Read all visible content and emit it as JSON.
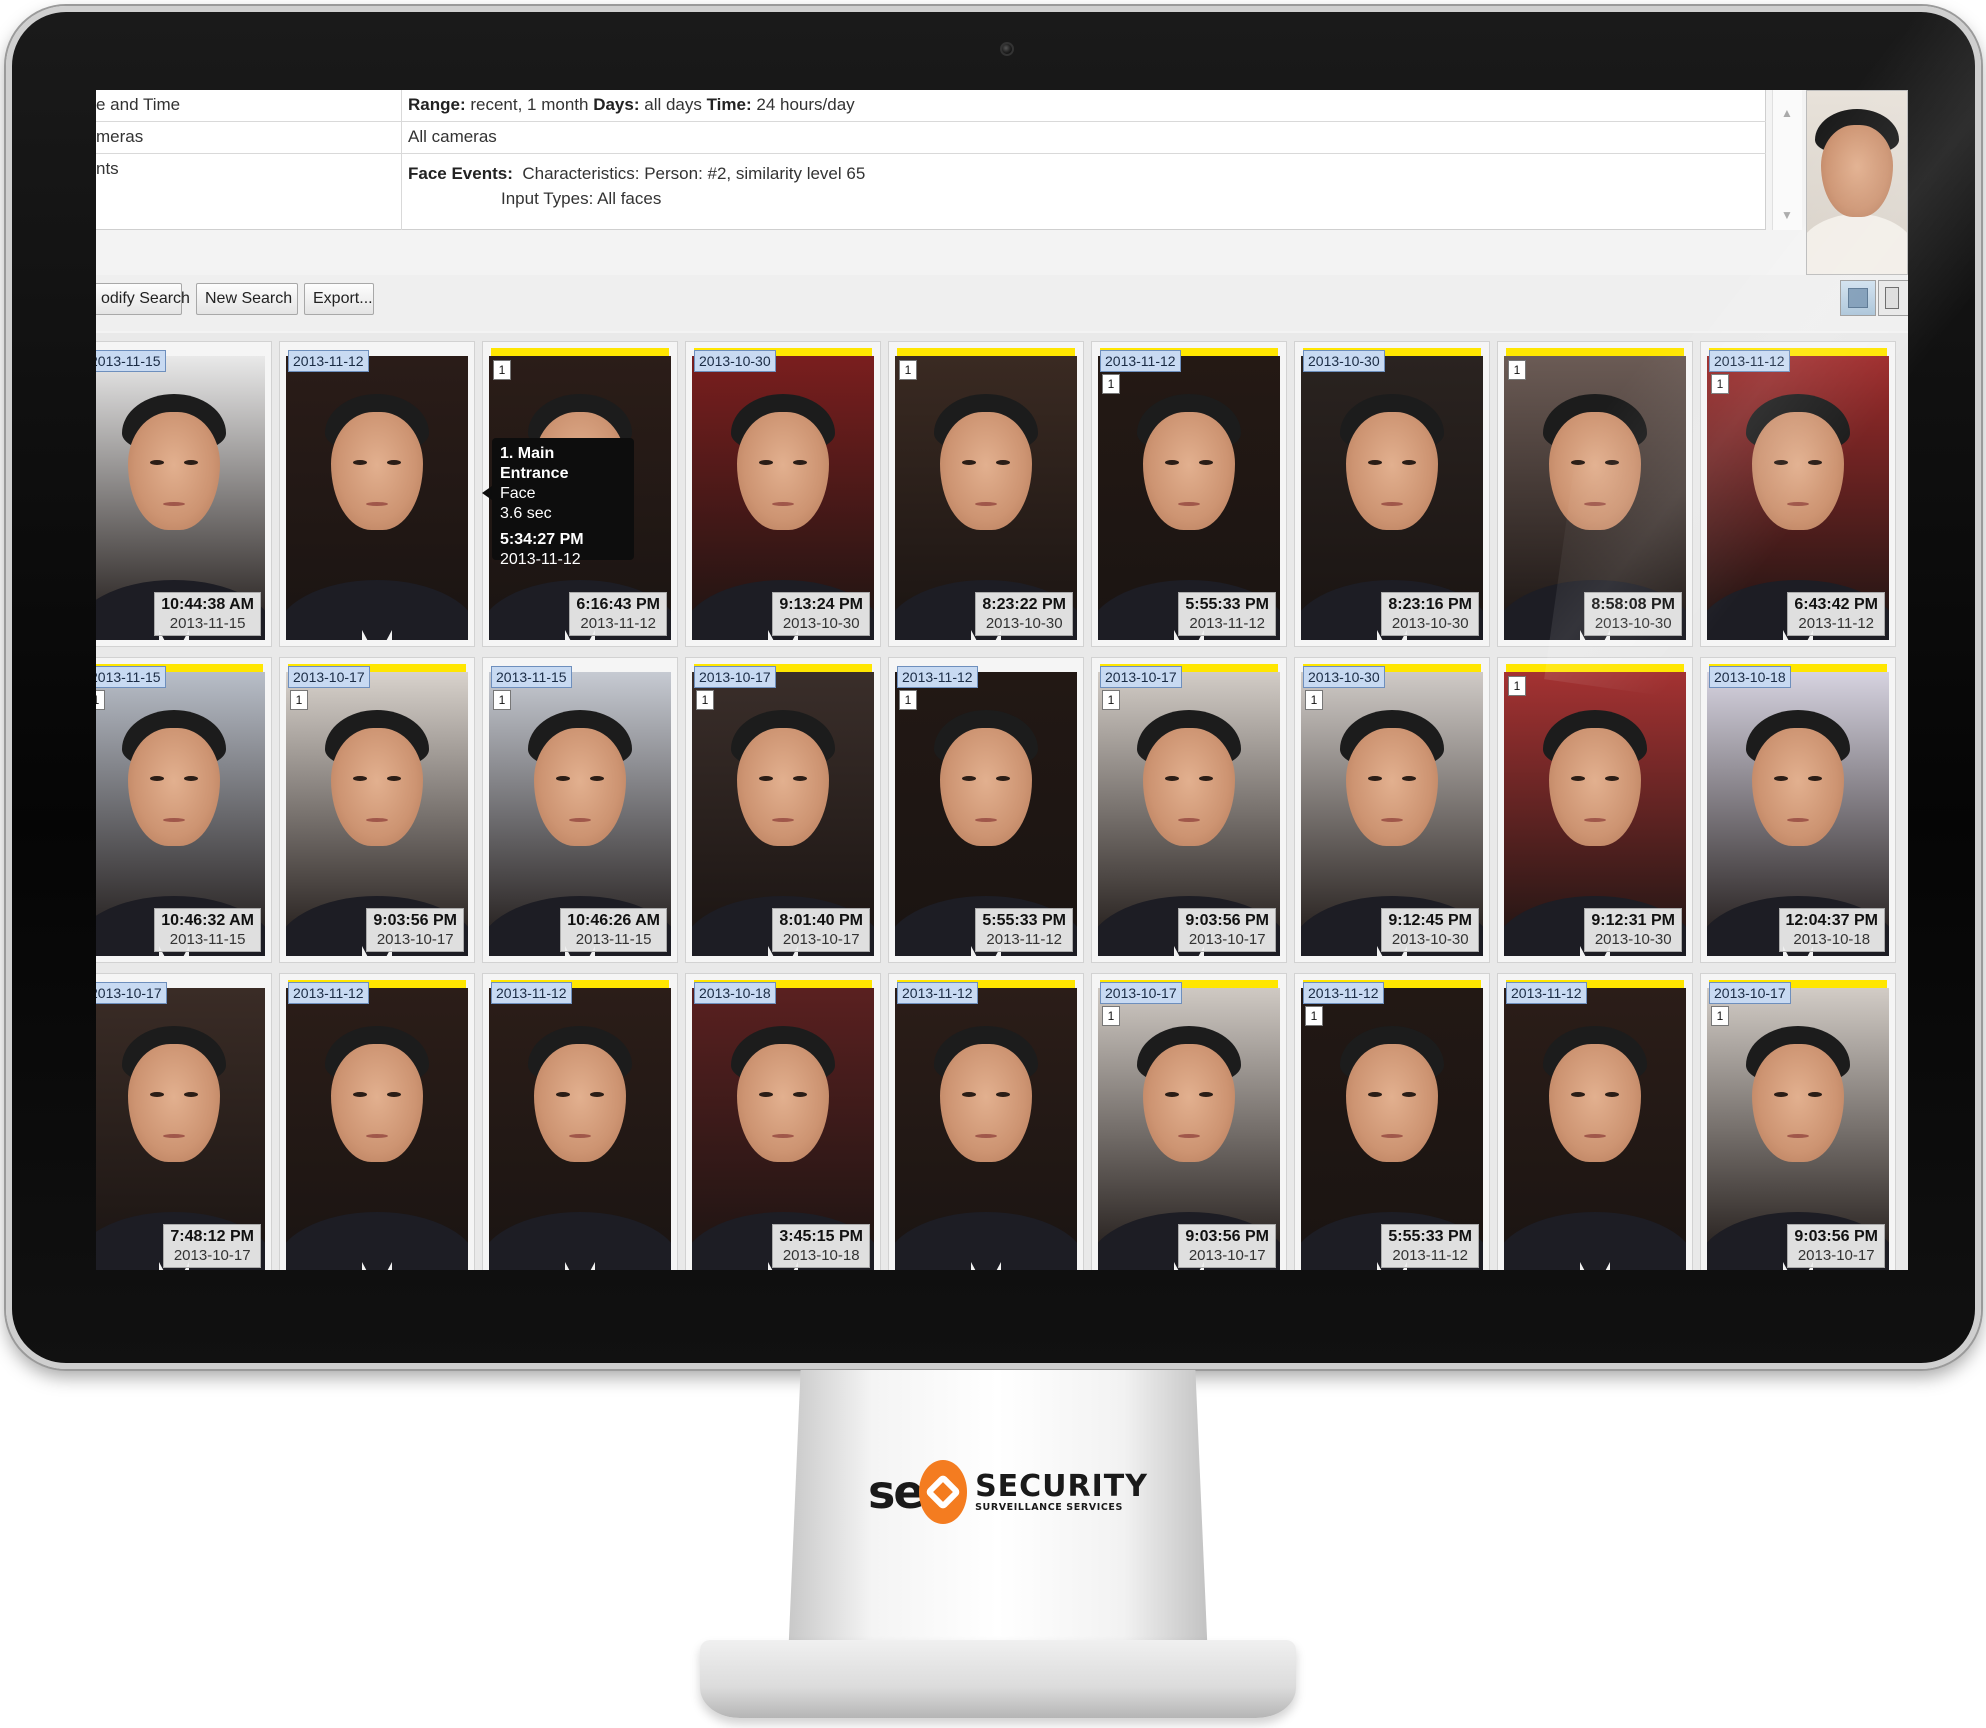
{
  "criteria": {
    "rows": [
      {
        "label": "e and Time",
        "value_parts": [
          {
            "b": "Range:",
            "t": " recent, 1 month  "
          },
          {
            "b": "Days:",
            "t": " all days  "
          },
          {
            "b": "Time:",
            "t": " 24 hours/day"
          }
        ]
      },
      {
        "label": "meras",
        "value_text": "All cameras"
      },
      {
        "label": "nts",
        "event_label": "Face Events:",
        "line1": "Characteristics:  Person:  #2, similarity level 65",
        "line2": "Input Types:  All faces"
      }
    ]
  },
  "toolbar": {
    "modify_label": "odify Search",
    "new_label": "New Search",
    "export_label": "Export..."
  },
  "tooltip": {
    "line1": "1. Main Entrance",
    "line2": "Face",
    "line3": "3.6 sec",
    "line4": "5:34:27 PM",
    "line5": "2013-11-12"
  },
  "results": [
    {
      "date": "2013-11-15",
      "time": "10:44:38 AM",
      "tdate": "2013-11-15",
      "bar": false,
      "num": "",
      "bg": "#e9e9e9"
    },
    {
      "date": "2013-11-12",
      "time": "",
      "tdate": "",
      "bar": false,
      "num": "",
      "bg": "#2a1c18"
    },
    {
      "date": "",
      "time": "6:16:43 PM",
      "tdate": "2013-11-12",
      "bar": true,
      "num": "1",
      "bg": "#2b1d18"
    },
    {
      "date": "2013-10-30",
      "time": "9:13:24 PM",
      "tdate": "2013-10-30",
      "bar": true,
      "num": "",
      "bg": "#7a1e1e"
    },
    {
      "date": "",
      "time": "8:23:22 PM",
      "tdate": "2013-10-30",
      "bar": true,
      "num": "1",
      "bg": "#3a2a22"
    },
    {
      "date": "2013-11-12",
      "time": "5:55:33 PM",
      "tdate": "2013-11-12",
      "bar": true,
      "num": "1",
      "bg": "#241914"
    },
    {
      "date": "2013-10-30",
      "time": "8:23:16 PM",
      "tdate": "2013-10-30",
      "bar": true,
      "num": "",
      "bg": "#2a2320"
    },
    {
      "date": "",
      "time": "8:58:08 PM",
      "tdate": "2013-10-30",
      "bar": true,
      "num": "1",
      "bg": "#6b5b55"
    },
    {
      "date": "2013-11-12",
      "time": "6:43:42 PM",
      "tdate": "2013-11-12",
      "bar": true,
      "num": "1",
      "bg": "#9e2b2b"
    },
    {
      "date": "2013-11-15",
      "time": "10:46:32 AM",
      "tdate": "2013-11-15",
      "bar": true,
      "num": "1",
      "bg": "#b8bec8"
    },
    {
      "date": "2013-10-17",
      "time": "9:03:56 PM",
      "tdate": "2013-10-17",
      "bar": true,
      "num": "1",
      "bg": "#d8d2cc"
    },
    {
      "date": "2013-11-15",
      "time": "10:46:26 AM",
      "tdate": "2013-11-15",
      "bar": false,
      "num": "1",
      "bg": "#c6cad2"
    },
    {
      "date": "2013-10-17",
      "time": "8:01:40 PM",
      "tdate": "2013-10-17",
      "bar": true,
      "num": "1",
      "bg": "#3a2e2a"
    },
    {
      "date": "2013-11-12",
      "time": "5:55:33 PM",
      "tdate": "2013-11-12",
      "bar": false,
      "num": "1",
      "bg": "#221814"
    },
    {
      "date": "2013-10-17",
      "time": "9:03:56 PM",
      "tdate": "2013-10-17",
      "bar": true,
      "num": "1",
      "bg": "#d2ccc6"
    },
    {
      "date": "2013-10-30",
      "time": "9:12:45 PM",
      "tdate": "2013-10-30",
      "bar": true,
      "num": "1",
      "bg": "#cfcac6"
    },
    {
      "date": "",
      "time": "9:12:31 PM",
      "tdate": "2013-10-30",
      "bar": true,
      "num": "1",
      "bg": "#a43232"
    },
    {
      "date": "2013-10-18",
      "time": "12:04:37 PM",
      "tdate": "2013-10-18",
      "bar": true,
      "num": "",
      "bg": "#d6d3e0"
    },
    {
      "date": "2013-10-17",
      "time": "7:48:12 PM",
      "tdate": "2013-10-17",
      "bar": false,
      "num": "",
      "bg": "#3a2c26"
    },
    {
      "date": "2013-11-12",
      "time": "",
      "tdate": "",
      "bar": true,
      "num": "",
      "bg": "#2b1d18"
    },
    {
      "date": "2013-11-12",
      "time": "",
      "tdate": "",
      "bar": true,
      "num": "",
      "bg": "#2b1d18"
    },
    {
      "date": "2013-10-18",
      "time": "3:45:15 PM",
      "tdate": "2013-10-18",
      "bar": true,
      "num": "",
      "bg": "#5a2020"
    },
    {
      "date": "2013-11-12",
      "time": "",
      "tdate": "",
      "bar": true,
      "num": "",
      "bg": "#2b1d18"
    },
    {
      "date": "2013-10-17",
      "time": "9:03:56 PM",
      "tdate": "2013-10-17",
      "bar": true,
      "num": "1",
      "bg": "#cfc9c3"
    },
    {
      "date": "2013-11-12",
      "time": "5:55:33 PM",
      "tdate": "2013-11-12",
      "bar": true,
      "num": "1",
      "bg": "#221814"
    },
    {
      "date": "2013-11-12",
      "time": "",
      "tdate": "",
      "bar": true,
      "num": "",
      "bg": "#2b1d18"
    },
    {
      "date": "2013-10-17",
      "time": "9:03:56 PM",
      "tdate": "2013-10-17",
      "bar": true,
      "num": "1",
      "bg": "#d2ccc6"
    }
  ],
  "brand": {
    "mark": "se",
    "title": "SECURITY",
    "subtitle": "SURVEILLANCE SERVICES",
    "accent": "#f47c20"
  },
  "colors": {
    "highlight_bar": "#ffe600",
    "date_tag": "#c8daf2"
  }
}
